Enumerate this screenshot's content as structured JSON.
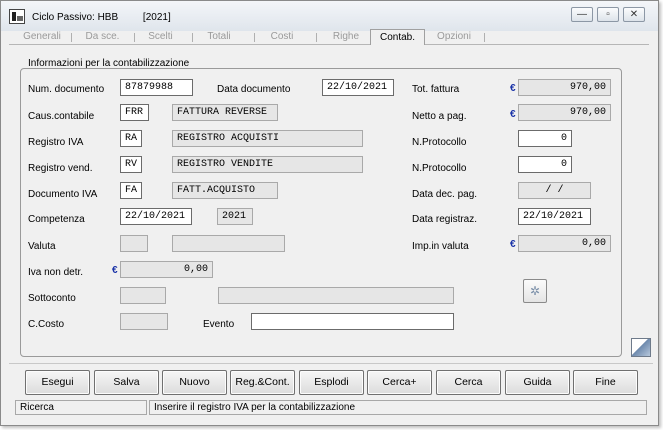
{
  "window": {
    "title": "Ciclo Passivo: HBB",
    "mode": "[2021]",
    "min_glyph": "—",
    "max_glyph": "▫",
    "close_glyph": "✕"
  },
  "tabs": [
    "Generali",
    "Da sce.",
    "Scelti",
    "Totali",
    "Costi",
    "Righe",
    "Contab.",
    "Opzioni"
  ],
  "active_tab": "Contab.",
  "panel": {
    "title": "Informazioni per la contabilizzazione"
  },
  "fields": {
    "num_documento": {
      "label": "Num. documento",
      "value": "87879988"
    },
    "data_documento": {
      "label": "Data documento",
      "value": "22/10/2021"
    },
    "caus_contabile": {
      "label": "Caus.contabile",
      "code": "FRR",
      "desc": "FATTURA REVERSE"
    },
    "registro_iva": {
      "label": "Registro IVA",
      "code": "RA",
      "desc": "REGISTRO ACQUISTI"
    },
    "registro_vend": {
      "label": "Registro vend.",
      "code": "RV",
      "desc": "REGISTRO VENDITE"
    },
    "documento_iva": {
      "label": "Documento IVA",
      "code": "FA",
      "desc": "FATT.ACQUISTO"
    },
    "competenza": {
      "label": "Competenza",
      "date": "22/10/2021",
      "year": "2021"
    },
    "valuta": {
      "label": "Valuta",
      "code": "",
      "desc": ""
    },
    "iva_non_detr": {
      "label": "Iva non detr.",
      "value": "0,00"
    },
    "sottoconto": {
      "label": "Sottoconto",
      "code": "",
      "desc": ""
    },
    "c_costo": {
      "label": "C.Costo",
      "value": ""
    },
    "evento": {
      "label": "Evento",
      "value": ""
    },
    "tot_fattura": {
      "label": "Tot. fattura",
      "value": "970,00"
    },
    "netto_a_pag": {
      "label": "Netto a pag.",
      "value": "970,00"
    },
    "n_protocollo_1": {
      "label": "N.Protocollo",
      "value": "0"
    },
    "n_protocollo_2": {
      "label": "N.Protocollo",
      "value": "0"
    },
    "data_dec_pag": {
      "label": "Data dec. pag.",
      "value": "/ /"
    },
    "data_registraz": {
      "label": "Data registraz.",
      "value": "22/10/2021"
    },
    "imp_in_valuta": {
      "label": "Imp.in valuta",
      "value": "0,00"
    }
  },
  "currency_symbol": "€",
  "buttons": [
    "Esegui",
    "Salva",
    "Nuovo",
    "Reg.&Cont.",
    "Esplodi",
    "Cerca+",
    "Cerca",
    "Guida",
    "Fine"
  ],
  "status": {
    "left": "Ricerca",
    "right": "Inserire il registro IVA per la contabilizzazione"
  },
  "colors": {
    "window_bg": "#f0f0f0",
    "readonly_field": "#e6e6e6",
    "currency_blue": "#1a33a8"
  }
}
